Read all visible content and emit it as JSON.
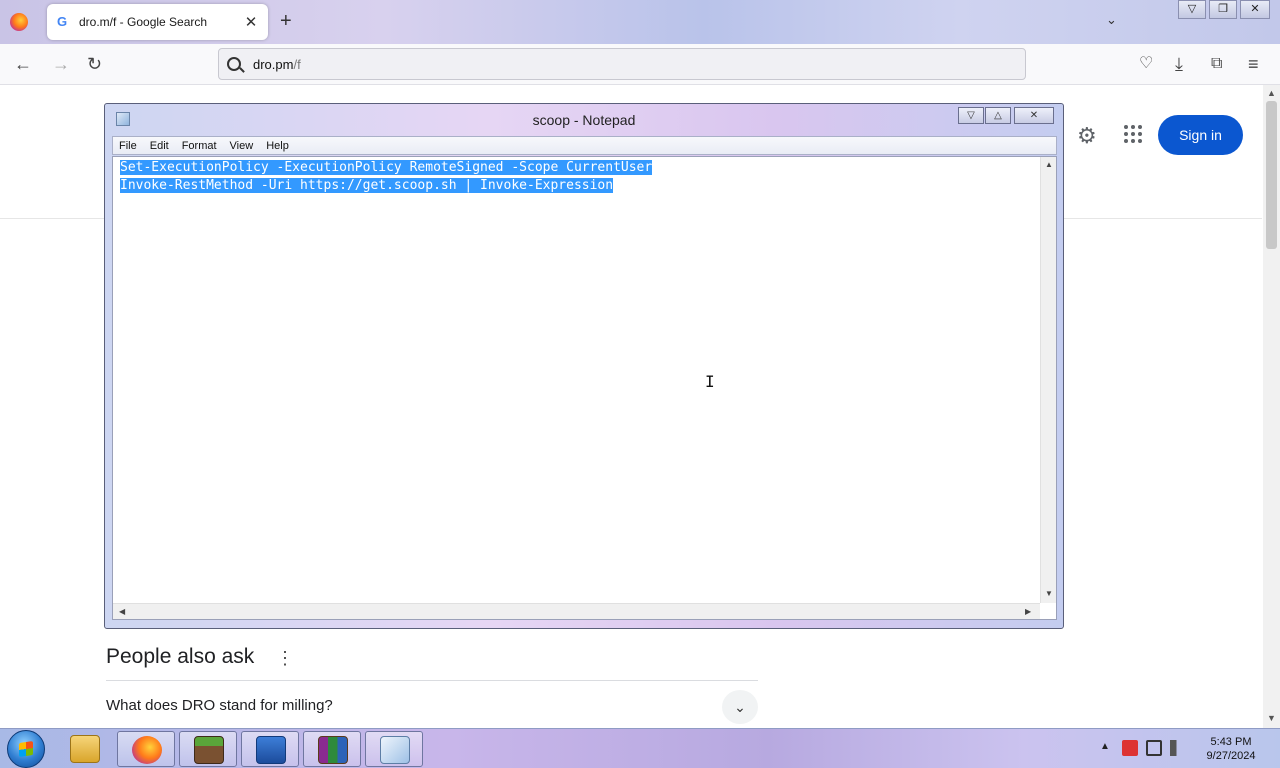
{
  "browser": {
    "tab": {
      "title": "dro.m/f - Google Search",
      "close_glyph": "✕"
    },
    "new_tab_glyph": "+",
    "tab_list_glyph": "⌄",
    "window_controls": {
      "minimize": "▽",
      "restore": "❐",
      "close": "✕"
    },
    "nav": {
      "back": "←",
      "forward": "→",
      "reload": "↻"
    },
    "url": {
      "host": "dro.pm",
      "path": "/f"
    },
    "toolbar_icons": [
      "pocket-icon",
      "download-icon",
      "extensions-icon",
      "menu-icon"
    ],
    "toolbar_glyphs": {
      "pocket": "♡",
      "download": "⤓",
      "extensions": "⧉",
      "menu": "≡"
    }
  },
  "google": {
    "settings_glyph": "⚙",
    "sign_in_label": "Sign in",
    "people_also_ask": {
      "title": "People also ask",
      "kebab": "⋮",
      "first_question": "What does DRO stand for milling?",
      "chevron": "⌄"
    }
  },
  "notepad": {
    "title": "scoop - Notepad",
    "controls": {
      "minimize": "▽",
      "maximize": "△",
      "close": "✕"
    },
    "menu": [
      "File",
      "Edit",
      "Format",
      "View",
      "Help"
    ],
    "lines": [
      "Set-ExecutionPolicy -ExecutionPolicy RemoteSigned -Scope CurrentUser",
      "Invoke-RestMethod -Uri https://get.scoop.sh | Invoke-Expression"
    ],
    "selection": "all"
  },
  "taskbar": {
    "pinned": [
      "explorer-icon",
      "firefox-icon",
      "minecraft-icon",
      "powershell-icon",
      "winrar-icon",
      "notepad-icon"
    ],
    "active": "notepad-icon",
    "clock": {
      "time": "5:43 PM",
      "date": "9/27/2024"
    },
    "colors": {
      "accent": "#0b57d0",
      "selection": "#3399ff"
    }
  }
}
